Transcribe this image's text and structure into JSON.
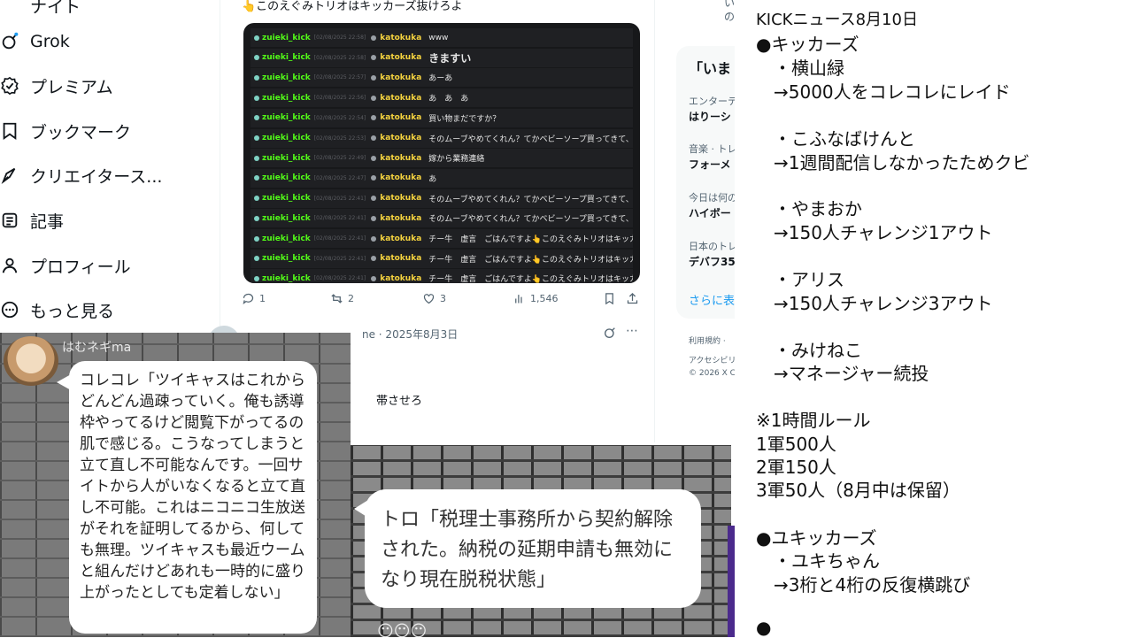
{
  "sidebar": {
    "items": [
      {
        "label": "Grok",
        "icon": "grok-icon"
      },
      {
        "label": "プレミアム",
        "icon": "premium-icon"
      },
      {
        "label": "ブックマーク",
        "icon": "bookmark-icon"
      },
      {
        "label": "クリエイタース...",
        "icon": "creator-icon"
      },
      {
        "label": "記事",
        "icon": "article-icon"
      },
      {
        "label": "プロフィール",
        "icon": "profile-icon"
      },
      {
        "label": "もっと見る",
        "icon": "more-icon"
      }
    ],
    "top_partial": "ナイト"
  },
  "tweet": {
    "text": "👆このえぐみトリオはキッカーズ抜けろよ",
    "chat": [
      {
        "user": "zuieki_kick",
        "time": "[02/08/2025 22:58]",
        "user2": "katokuka",
        "msg": "www",
        "big": false
      },
      {
        "user": "zuieki_kick",
        "time": "[02/08/2025 22:58]",
        "user2": "katokuka",
        "msg": "きますい",
        "big": true
      },
      {
        "user": "zuieki_kick",
        "time": "[02/08/2025 22:57]",
        "user2": "katokuka",
        "msg": "あーあ",
        "big": false
      },
      {
        "user": "zuieki_kick",
        "time": "[02/08/2025 22:56]",
        "user2": "katokuka",
        "msg": "あ　あ　あ",
        "big": false
      },
      {
        "user": "zuieki_kick",
        "time": "[02/08/2025 22:54]",
        "user2": "katokuka",
        "msg": "買い物まだですか？",
        "big": false
      },
      {
        "user": "zuieki_kick",
        "time": "[02/08/2025 22:53]",
        "user2": "katokuka",
        "msg": "そのムーブやめてくれん？てかベビーソープ買ってきて、詰め替え用",
        "big": false
      },
      {
        "user": "zuieki_kick",
        "time": "[02/08/2025 22:49]",
        "user2": "katokuka",
        "msg": "嫁から業務連絡",
        "big": false
      },
      {
        "user": "zuieki_kick",
        "time": "[02/08/2025 22:47]",
        "user2": "katokuka",
        "msg": "あ",
        "big": false
      },
      {
        "user": "zuieki_kick",
        "time": "[02/08/2025 22:41]",
        "user2": "katokuka",
        "msg": "そのムーブやめてくれん？てかベビーソープ買ってきて、詰め替え用",
        "big": false
      },
      {
        "user": "zuieki_kick",
        "time": "[02/08/2025 22:41]",
        "user2": "katokuka",
        "msg": "そのムーブやめてくれん？てかベビーソープ買ってきて、詰め替え用",
        "big": false
      },
      {
        "user": "zuieki_kick",
        "time": "[02/08/2025 22:41]",
        "user2": "katokuka",
        "msg": "チー牛　虚言　ごはんですよ👆このえぐみトリオはキッカーズ抜けろよ",
        "big": false
      },
      {
        "user": "zuieki_kick",
        "time": "[02/08/2025 22:41]",
        "user2": "katokuka",
        "msg": "チー牛　虚言　ごはんですよ👆このえぐみトリオはキッカーズ抜けろよ",
        "big": false
      },
      {
        "user": "zuieki_kick",
        "time": "[02/08/2025 22:41]",
        "user2": "katokuka",
        "msg": "チー牛　虚言　ごはんですよ👆このえぐみトリオはキッカーズ抜けろよ",
        "big": false
      }
    ],
    "actions": {
      "replies": "1",
      "reposts": "2",
      "likes": "3",
      "views": "1,546"
    },
    "next_meta": "ne · 2025年8月3日",
    "next_text": "帯させろ"
  },
  "rightcol": {
    "partial_top": "い",
    "partial_top2": "の",
    "trend_heading": "「いま",
    "trends": [
      {
        "cat": "エンターテ",
        "name": "はりーシ"
      },
      {
        "cat": "音楽 · トレ",
        "name": "フォーメ"
      },
      {
        "cat": "今日は何の",
        "name": "ハイボー"
      },
      {
        "cat": "日本のトレ",
        "name": "デバフ35"
      }
    ],
    "show_more": "さらに表",
    "footer": [
      "利用規約 ·",
      "アクセシビリ",
      "© 2026 X Co"
    ]
  },
  "hamster": {
    "name": "はむネギma",
    "text": "コレコレ「ツイキャスはこれからどんどん過疎っていく。俺も誘導枠やってるけど閲覧下がってるの肌で感じる。こうなってしまうと立て直し不可能なんです。一回サイトから人がいなくなると立て直し不可能。これはニコニコ生放送がそれを証明してるから、何しても無理。ツイキャスも最近ウームと組んだけどあれも一時的に盛り上がったとしても定着しない」"
  },
  "toro": {
    "text": "トロ「税理士事務所から契約解除された。納税の延期申請も無効になり現在脱税状態」",
    "faces": "😶😶😶"
  },
  "news": {
    "lines": [
      "KICKニュース8月10日",
      "●キッカーズ",
      "　・横山緑",
      "　→5000人をコレコレにレイド",
      "",
      "　・こふなばけんと",
      "　→1週間配信しなかったためクビ",
      "",
      "　・やまおか",
      "　→150人チャレンジ1アウト",
      "",
      "　・アリス",
      "　→150人チャレンジ3アウト",
      "",
      "　・みけねこ",
      "　→マネージャー続投",
      "",
      "※1時間ルール",
      "1軍500人",
      "2軍150人",
      "3軍50人（8月中は保留）",
      "",
      "●ユキッカーズ",
      "　・ユキちゃん",
      "　→3桁と4桁の反復横跳び",
      "",
      "●"
    ]
  }
}
